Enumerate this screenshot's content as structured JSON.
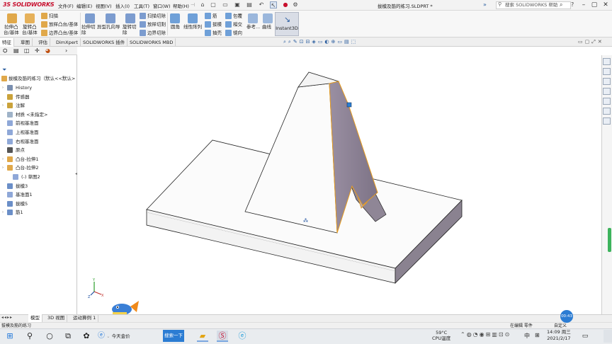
{
  "app": {
    "logo_prefix": "3S",
    "logo_text": "SOLIDWORKS"
  },
  "menus": [
    "文件(F)",
    "编辑(E)",
    "视图(V)",
    "插入(I)",
    "工具(T)",
    "窗口(W)",
    "帮助(H)"
  ],
  "document_title": "拔模及筋的练习.SLDPRT *",
  "help_search_placeholder": "搜索 SOLIDWORKS 帮助",
  "ribbon": {
    "extrude_boss": "拉伸凸\n台/基体",
    "revolve_boss": "旋转凸\n台/基体",
    "sweep": "扫描",
    "loft": "放样凸台/基体",
    "boundary_boss": "边界凸台/基体",
    "extrude_cut": "拉伸切\n除",
    "hole_wizard": "异型孔向导",
    "revolve_cut": "旋转切\n除",
    "swept_cut": "扫描切除",
    "lofted_cut": "放样切割",
    "boundary_cut": "边界切除",
    "fillet": "圆角",
    "linear_pattern": "线性阵列",
    "rib": "筋",
    "draft": "拔模",
    "shell": "抽壳",
    "wrap": "包覆",
    "intersect": "相交",
    "mirror": "镜向",
    "reference": "参考...",
    "curves": "曲线",
    "instant3d": "Instant3D"
  },
  "command_tabs": [
    "特征",
    "草图",
    "评估",
    "DimXpert",
    "SOLIDWORKS 插件",
    "SOLIDWORKS MBD"
  ],
  "active_command_tab": "特征",
  "feature_tree": {
    "root": "拔模及筋的练习（默认<<默认>",
    "items": [
      {
        "label": "History",
        "expandable": true,
        "indent": 0,
        "color": "#7a8fb0"
      },
      {
        "label": "传感器",
        "expandable": false,
        "indent": 0,
        "color": "#caa23a"
      },
      {
        "label": "注解",
        "expandable": true,
        "indent": 0,
        "color": "#caa23a"
      },
      {
        "label": "材质 <未指定>",
        "expandable": false,
        "indent": 0,
        "color": "#9fb3c8"
      },
      {
        "label": "前视基准面",
        "expandable": false,
        "indent": 0,
        "color": "#8fa8d8"
      },
      {
        "label": "上视基准面",
        "expandable": false,
        "indent": 0,
        "color": "#8fa8d8"
      },
      {
        "label": "右视基准面",
        "expandable": false,
        "indent": 0,
        "color": "#8fa8d8"
      },
      {
        "label": "原点",
        "expandable": false,
        "indent": 0,
        "color": "#555555"
      },
      {
        "label": "凸台-拉伸1",
        "expandable": true,
        "indent": 0,
        "color": "#e0a84a"
      },
      {
        "label": "凸台-拉伸2",
        "expandable": true,
        "indent": 0,
        "color": "#e0a84a"
      },
      {
        "label": "(-) 草图2",
        "expandable": false,
        "indent": 1,
        "color": "#8fa8d8"
      },
      {
        "label": "拔模3",
        "expandable": false,
        "indent": 0,
        "color": "#6b8fc8"
      },
      {
        "label": "基准面1",
        "expandable": false,
        "indent": 0,
        "color": "#8fa8d8"
      },
      {
        "label": "拔模5",
        "expandable": false,
        "indent": 0,
        "color": "#6b8fc8"
      },
      {
        "label": "筋1",
        "expandable": true,
        "indent": 0,
        "color": "#6b8fc8"
      }
    ]
  },
  "bottom_tabs": [
    "模型",
    "3D 视图",
    "运动算例 1"
  ],
  "active_bottom_tab": "模型",
  "status": {
    "left": "拔模及筋的练习",
    "editing": "在编辑 零件",
    "custom": "自定义"
  },
  "taskbar": {
    "search_button": "搜索一下",
    "edge_text": "今天金价",
    "temperature": "59°C",
    "cpu_label": "CPU温度",
    "ime": "中",
    "time": "14:09 周三",
    "date": "2021/2/17",
    "badge_time": "00:43"
  }
}
